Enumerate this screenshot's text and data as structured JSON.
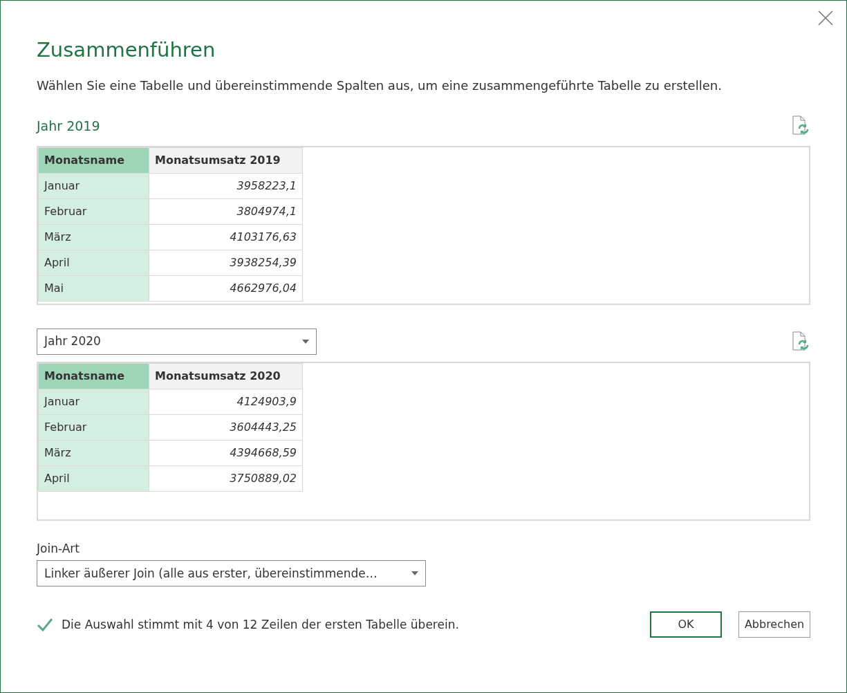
{
  "title": "Zusammenführen",
  "description": "Wählen Sie eine Tabelle und übereinstimmende Spalten aus, um eine zusammengeführte Tabelle zu erstellen.",
  "tables": [
    {
      "kind": "label",
      "source": "Jahr 2019",
      "columns": [
        {
          "label": "Monatsname",
          "selected": true
        },
        {
          "label": "Monatsumsatz 2019",
          "selected": false
        }
      ],
      "rows": [
        [
          "Januar",
          "3958223,1"
        ],
        [
          "Februar",
          "3804974,1"
        ],
        [
          "März",
          "4103176,63"
        ],
        [
          "April",
          "3938254,39"
        ],
        [
          "Mai",
          "4662976,04"
        ]
      ]
    },
    {
      "kind": "dropdown",
      "source": "Jahr 2020",
      "columns": [
        {
          "label": "Monatsname",
          "selected": true
        },
        {
          "label": "Monatsumsatz 2020",
          "selected": false
        }
      ],
      "rows": [
        [
          "Januar",
          "4124903,9"
        ],
        [
          "Februar",
          "3604443,25"
        ],
        [
          "März",
          "4394668,59"
        ],
        [
          "April",
          "3750889,02"
        ]
      ]
    }
  ],
  "join": {
    "label": "Join-Art",
    "value": "Linker äußerer Join (alle aus erster, übereinstimmende…"
  },
  "status": "Die Auswahl stimmt mit 4 von 12 Zeilen der ersten Tabelle überein.",
  "buttons": [
    {
      "label": "OK",
      "kind": "primary"
    },
    {
      "label": "Abbrechen",
      "kind": "secondary"
    }
  ]
}
